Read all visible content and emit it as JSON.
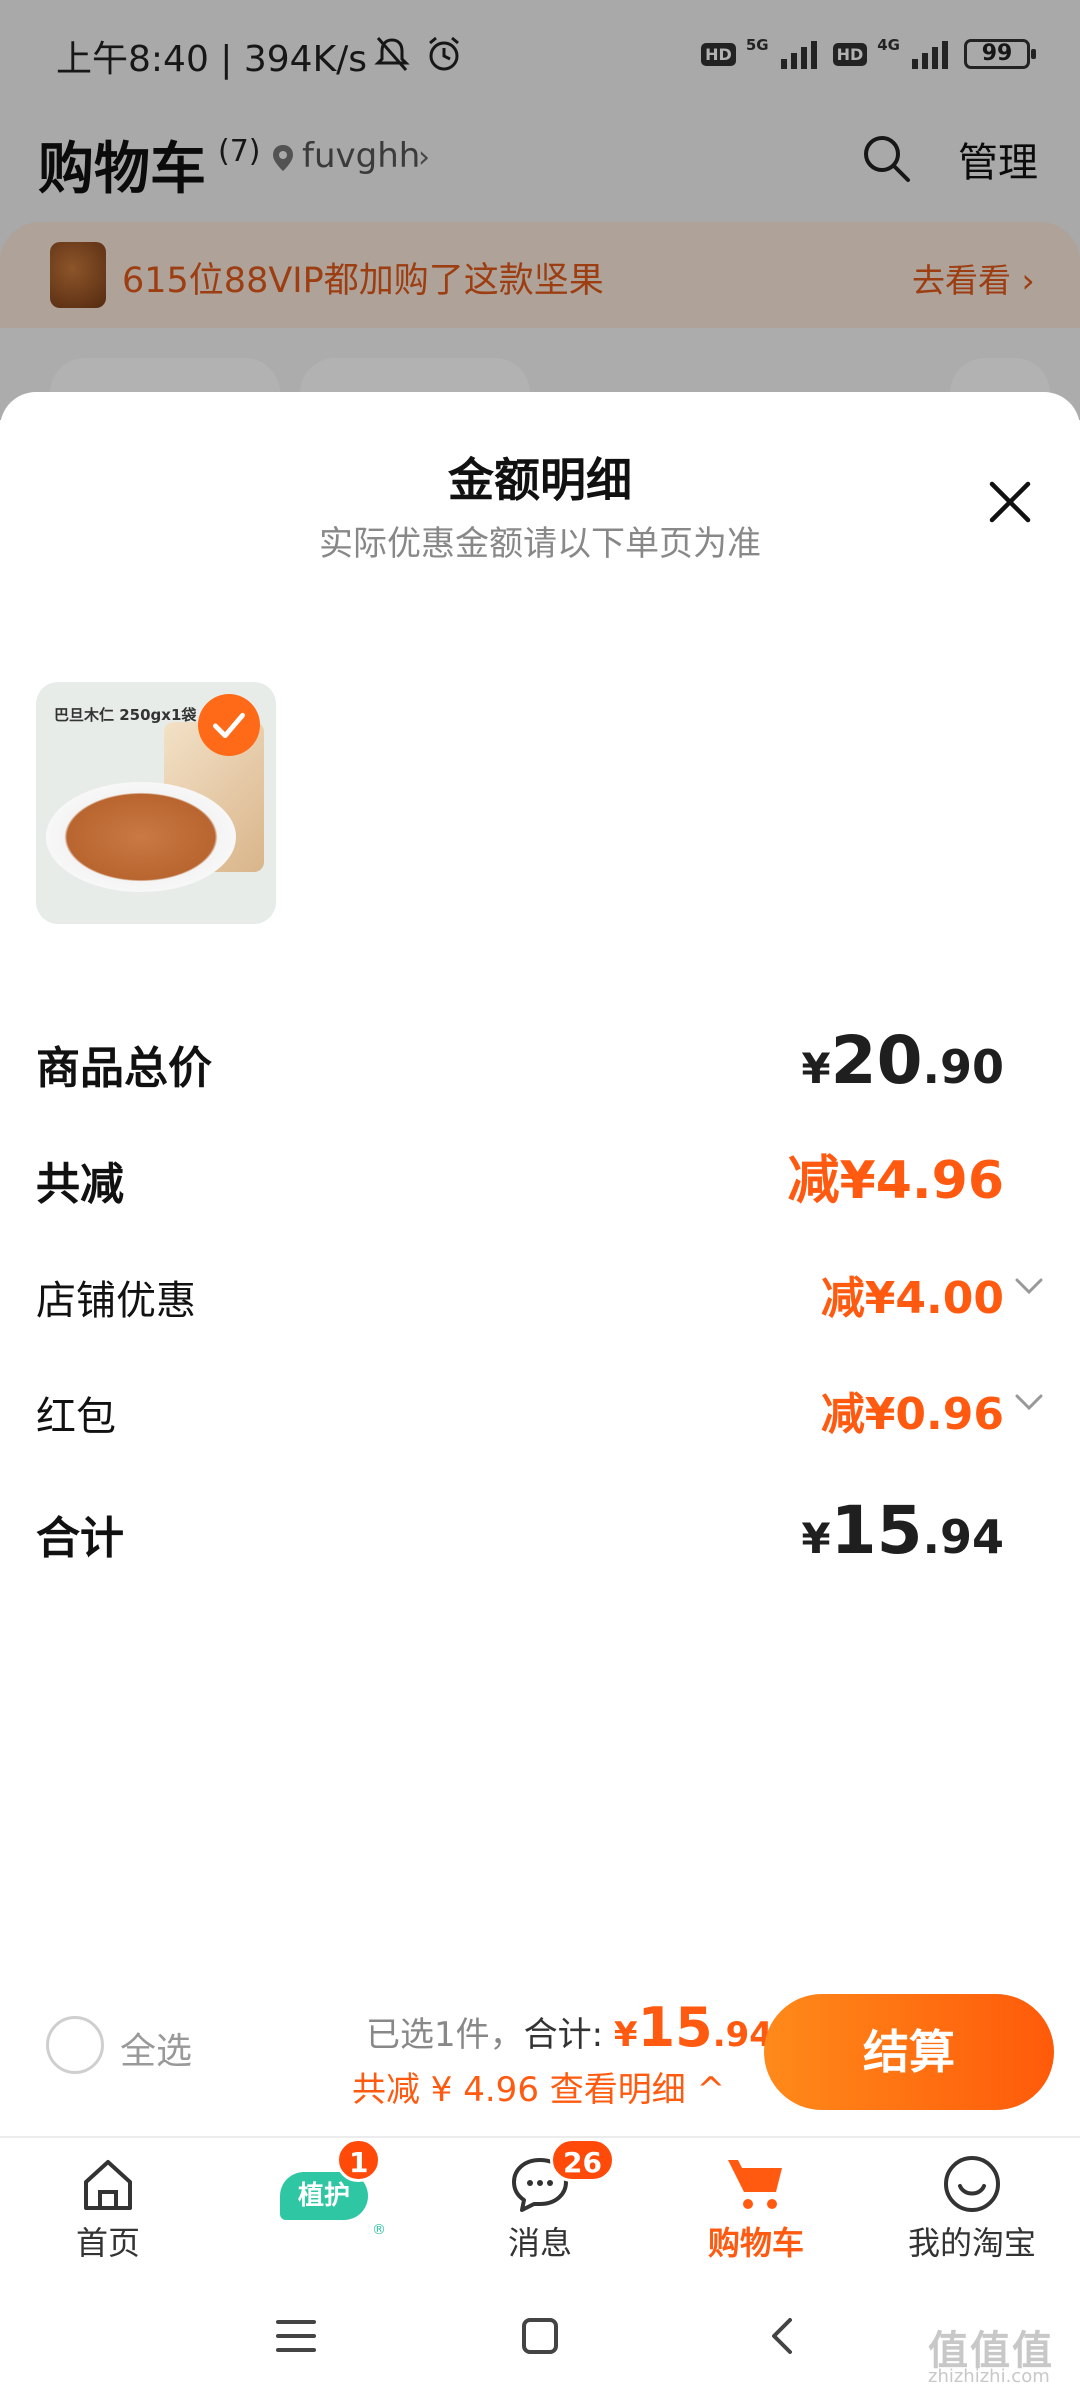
{
  "status_bar": {
    "text": "上午8:40 | 394K/s",
    "net1": "5G",
    "net2": "4G",
    "hd": "HD",
    "battery": "99"
  },
  "cart_header": {
    "title": "购物车",
    "count": "(7)",
    "location": "fuvghh",
    "manage": "管理",
    "chevron": "›"
  },
  "promo": {
    "text": "615位88VIP都加购了这款坚果",
    "link": "去看看 ›"
  },
  "sheet": {
    "title": "金额明细",
    "subtitle": "实际优惠金额请以下单页为准",
    "product": {
      "package_text": "巴旦木仁 250gx1袋"
    },
    "rows": {
      "subtotal": {
        "label": "商品总价",
        "currency": "¥",
        "int": "20",
        "dec": ".90"
      },
      "discount_total": {
        "label": "共减",
        "value": "减¥4.96"
      },
      "store_discount": {
        "label": "店铺优惠",
        "value": "减¥4.00"
      },
      "red_packet": {
        "label": "红包",
        "value": "减¥0.96"
      },
      "total": {
        "label": "合计",
        "currency": "¥",
        "int": "15",
        "dec": ".94"
      }
    }
  },
  "checkout": {
    "select_all": "全选",
    "selected": "已选1件，",
    "total_label": "合计: ",
    "total_currency": "¥",
    "total_int": "15",
    "total_dec": ".94",
    "discount_line": "共减 ¥ 4.96  查看明细 ^",
    "button": "结算"
  },
  "tabs": [
    {
      "label": "首页",
      "icon": "home-icon"
    },
    {
      "label": "植护",
      "icon": "plant-care-icon",
      "badge": "1"
    },
    {
      "label": "消息",
      "icon": "message-icon",
      "badge": "26"
    },
    {
      "label": "购物车",
      "icon": "cart-icon",
      "active": true
    },
    {
      "label": "我的淘宝",
      "icon": "smile-icon"
    }
  ],
  "watermark": {
    "text": "值值值",
    "sub": "zhizhizhi.com"
  },
  "colors": {
    "accent": "#ff5a10",
    "promo_bg": "#fbe8dc",
    "plant": "#2fc7a3"
  }
}
